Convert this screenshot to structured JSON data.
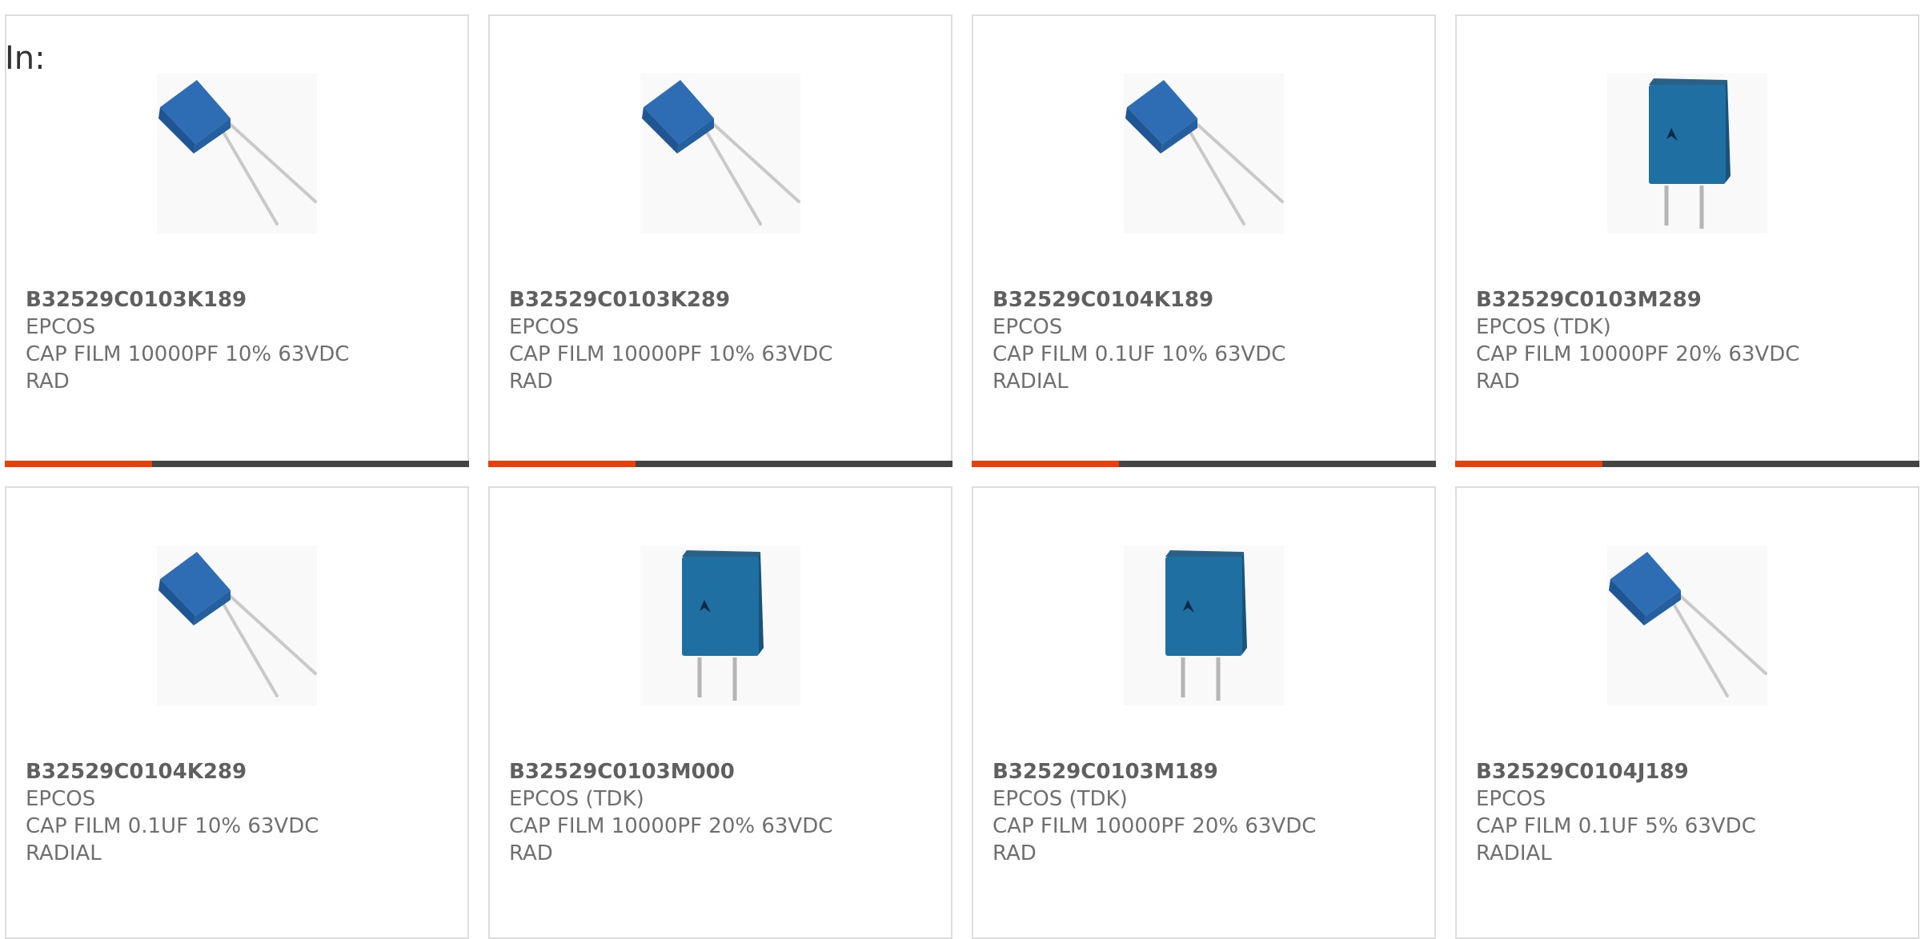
{
  "header": {
    "label": "In:"
  },
  "colors": {
    "accent": "#e8400c",
    "bar": "#444444",
    "capacitor_body": "#2e6db4",
    "capacitor_box": "#1f6fa3"
  },
  "products": [
    {
      "part_number": "B32529C0103K189",
      "manufacturer": "EPCOS",
      "description": "CAP FILM 10000PF 10% 63VDC",
      "package": "RAD",
      "image_icon": "capacitor-radial-angled-icon"
    },
    {
      "part_number": "B32529C0103K289",
      "manufacturer": "EPCOS",
      "description": "CAP FILM 10000PF 10% 63VDC",
      "package": "RAD",
      "image_icon": "capacitor-radial-angled-icon"
    },
    {
      "part_number": "B32529C0104K189",
      "manufacturer": "EPCOS",
      "description": "CAP FILM 0.1UF 10% 63VDC",
      "package": "RADIAL",
      "image_icon": "capacitor-radial-angled-icon"
    },
    {
      "part_number": "B32529C0103M289",
      "manufacturer": "EPCOS (TDK)",
      "description": "CAP FILM 10000PF 20% 63VDC",
      "package": "RAD",
      "image_icon": "capacitor-box-upright-icon"
    },
    {
      "part_number": "B32529C0104K289",
      "manufacturer": "EPCOS",
      "description": "CAP FILM 0.1UF 10% 63VDC",
      "package": "RADIAL",
      "image_icon": "capacitor-radial-angled-icon"
    },
    {
      "part_number": "B32529C0103M000",
      "manufacturer": "EPCOS (TDK)",
      "description": "CAP FILM 10000PF 20% 63VDC",
      "package": "RAD",
      "image_icon": "capacitor-box-upright-icon"
    },
    {
      "part_number": "B32529C0103M189",
      "manufacturer": "EPCOS (TDK)",
      "description": "CAP FILM 10000PF 20% 63VDC",
      "package": "RAD",
      "image_icon": "capacitor-box-upright-icon"
    },
    {
      "part_number": "B32529C0104J189",
      "manufacturer": "EPCOS",
      "description": "CAP FILM 0.1UF 5% 63VDC",
      "package": "RADIAL",
      "image_icon": "capacitor-radial-angled-icon"
    }
  ]
}
